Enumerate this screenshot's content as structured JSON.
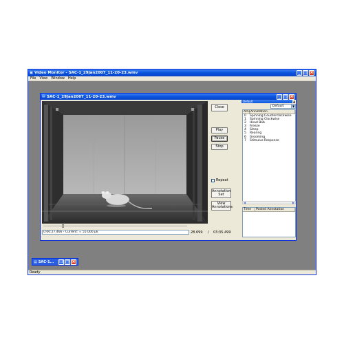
{
  "app": {
    "title": "Video Monitor - SAC-1_29Jan2007_11-20-23.wmv",
    "menu": [
      "File",
      "View",
      "Window",
      "Help"
    ],
    "status": "Ready"
  },
  "video_window": {
    "title": "SAC-1_29Jan2007_11-20-23.wmv",
    "info": "0:00:27.466 - Current: = 55.000 μk",
    "frame": "28.699",
    "separator": "/",
    "total_time": "03:35.499",
    "scrub_progress": 0.13
  },
  "buttons": {
    "close": "Close",
    "play": "Play",
    "pause": "Pause",
    "stop": "Stop",
    "repeat": "Repeat",
    "annotation_set_line1": "Annotation",
    "annotation_set_line2": "Set",
    "view_annotations_line1": "View",
    "view_annotations_line2": "Annotations"
  },
  "annotation_panel": {
    "header": "Default",
    "dropdown_value": "Default",
    "col_key": "Alt+",
    "col_name": "Annotation",
    "items": [
      {
        "key": "0",
        "name": "Spinning Counterclockwise"
      },
      {
        "key": "1",
        "name": "Spinning Clockwise"
      },
      {
        "key": "2",
        "name": "Head Bob"
      },
      {
        "key": "3",
        "name": "Freeze"
      },
      {
        "key": "4",
        "name": "Sleep"
      },
      {
        "key": "5",
        "name": "Rearing"
      },
      {
        "key": "6",
        "name": "Grooming"
      },
      {
        "key": "7",
        "name": "Stimulus Response"
      }
    ],
    "posted_col_time": "Time",
    "posted_col_name": "Posted Annotation"
  },
  "minimized": {
    "title": "SAC-1..."
  },
  "colors": {
    "title_bar": "#0a53de",
    "window_face": "#ece9d8",
    "mdi_background": "#808080",
    "close_button": "#c8341d"
  }
}
